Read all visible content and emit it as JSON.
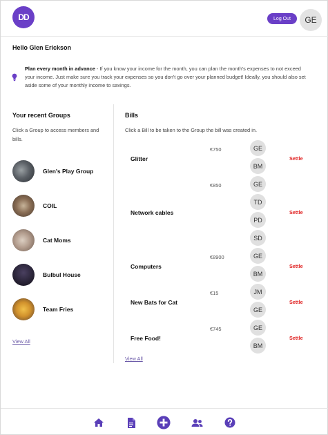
{
  "header": {
    "logo_text": "DD",
    "logout_label": "Log Out",
    "avatar_initials": "GE",
    "accent_color": "#6a3fc7"
  },
  "greeting": "Hello Glen Erickson",
  "tip": {
    "icon": "lightbulb-icon",
    "heading": "Plan every month in advance",
    "body": " - If you know your income for the month, you can plan the month's expenses to not exceed your income. Just make sure you track your expenses so you don't go over your planned budget! Ideally, you should also set aside some of your monthly income to savings."
  },
  "groups": {
    "title": "Your recent Groups",
    "subtitle": "Click a Group to access members and bills.",
    "items": [
      {
        "name": "Glen's Play Group"
      },
      {
        "name": "COIL"
      },
      {
        "name": "Cat Moms"
      },
      {
        "name": "Bulbul House"
      },
      {
        "name": "Team Fries"
      }
    ],
    "view_all": "View All"
  },
  "bills": {
    "title": "Bills",
    "subtitle": "Click a Bill to be taken to the Group the bill was created in.",
    "items": [
      {
        "name": "Glitter",
        "amount": "€750",
        "members": [
          "GE",
          "BM"
        ],
        "action": "Settle"
      },
      {
        "name": "Network cables",
        "amount": "€850",
        "members": [
          "GE",
          "TD",
          "PD",
          "SD"
        ],
        "action": "Settle"
      },
      {
        "name": "Computers",
        "amount": "€8900",
        "members": [
          "GE",
          "BM"
        ],
        "action": "Settle"
      },
      {
        "name": "New Bats for Cat",
        "amount": "€15",
        "members": [
          "JM",
          "GE"
        ],
        "action": "Settle"
      },
      {
        "name": "Free Food!",
        "amount": "€745",
        "members": [
          "GE",
          "BM"
        ],
        "action": "Settle"
      }
    ],
    "view_all": "View All",
    "settle_color": "#e02020"
  },
  "footer_nav": [
    "home-icon",
    "document-icon",
    "add-icon",
    "users-icon",
    "help-icon"
  ]
}
